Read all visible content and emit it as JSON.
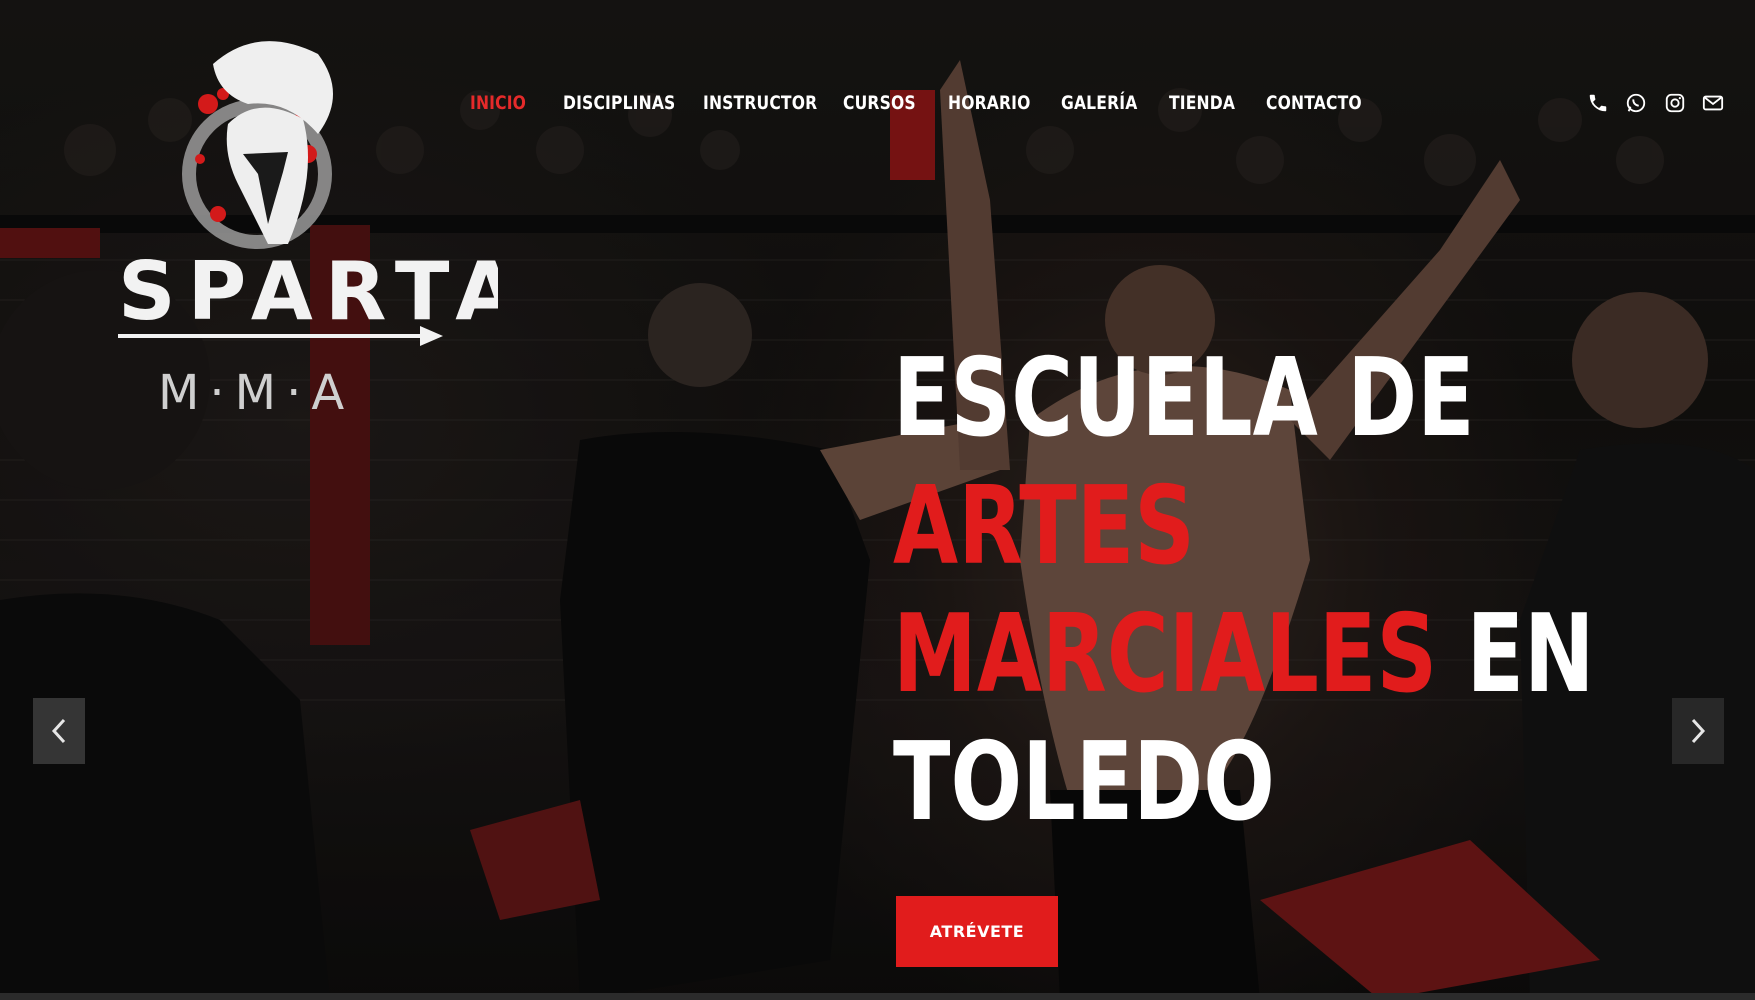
{
  "brand": {
    "name": "SPARTA",
    "sub": "M·M·A"
  },
  "nav": {
    "items": [
      {
        "label": "INICIO",
        "active": true
      },
      {
        "label": "DISCIPLINAS"
      },
      {
        "label": "INSTRUCTOR"
      },
      {
        "label": "CURSOS"
      },
      {
        "label": "HORARIO"
      },
      {
        "label": "GALERÍA"
      },
      {
        "label": "TIENDA"
      },
      {
        "label": "CONTACTO"
      }
    ]
  },
  "social": [
    "phone-icon",
    "whatsapp-icon",
    "instagram-icon",
    "mail-icon"
  ],
  "hero": {
    "line1": "ESCUELA DE",
    "line2": "ARTES",
    "line3_red": "MARCIALES",
    "line3_white": " EN",
    "line4": "TOLEDO",
    "cta": "ATRÉVETE"
  },
  "colors": {
    "accent": "#e11c1c",
    "text": "#ffffff"
  }
}
